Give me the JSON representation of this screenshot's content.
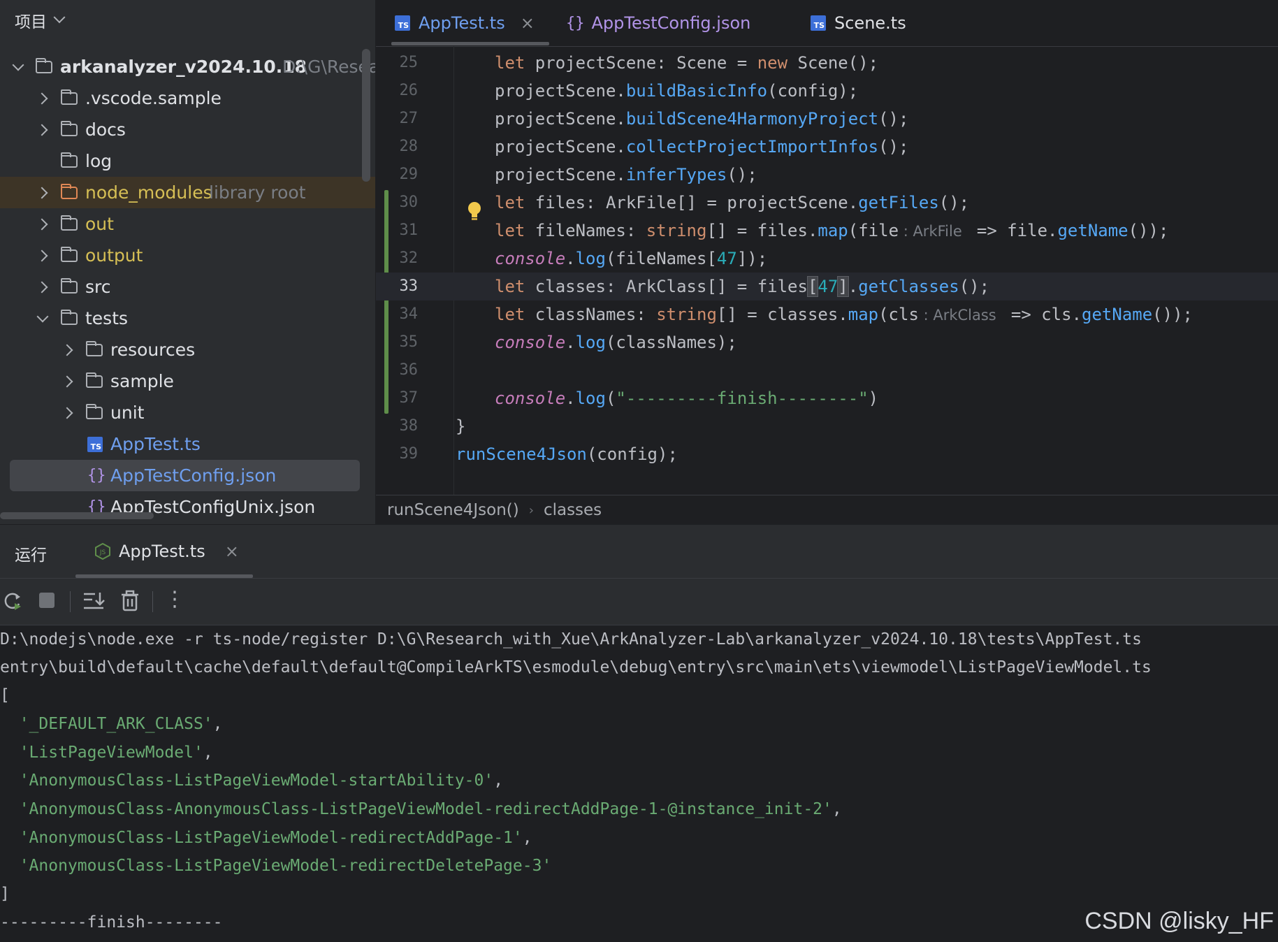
{
  "project_panel": {
    "title": "项目",
    "tree": [
      {
        "label": "arkanalyzer_v2024.10.18",
        "hint": "D:\\G\\Resea"
      },
      {
        "label": ".vscode.sample"
      },
      {
        "label": "docs"
      },
      {
        "label": "log"
      },
      {
        "label": "node_modules",
        "hint": "library root"
      },
      {
        "label": "out"
      },
      {
        "label": "output"
      },
      {
        "label": "src"
      },
      {
        "label": "tests"
      },
      {
        "label": "resources"
      },
      {
        "label": "sample"
      },
      {
        "label": "unit"
      },
      {
        "label": "AppTest.ts",
        "icon": "TS"
      },
      {
        "label": "AppTestConfig.json",
        "icon": "{}"
      },
      {
        "label": "AppTestConfigUnix.json",
        "icon": "{}"
      }
    ]
  },
  "editor": {
    "tabs": [
      {
        "label": "AppTest.ts",
        "icon": "TS",
        "close": "×"
      },
      {
        "label": "AppTestConfig.json",
        "icon": "{}"
      },
      {
        "label": "Scene.ts",
        "icon": "TS"
      }
    ],
    "line_numbers": [
      "25",
      "26",
      "27",
      "28",
      "29",
      "30",
      "31",
      "32",
      "33",
      "34",
      "35",
      "36",
      "37",
      "38",
      "39"
    ],
    "code": {
      "l25": {
        "let": "let",
        "a": " projectScene: Scene = ",
        "new": "new",
        "b": " Scene();"
      },
      "l26": {
        "a": "projectScene.",
        "fn": "buildBasicInfo",
        "b": "(config);"
      },
      "l27": {
        "a": "projectScene.",
        "fn": "buildScene4HarmonyProject",
        "b": "();"
      },
      "l28": {
        "a": "projectScene.",
        "fn": "collectProjectImportInfos",
        "b": "();"
      },
      "l29": {
        "a": "projectScene.",
        "fn": "inferTypes",
        "b": "();"
      },
      "l30": {
        "let": "let",
        "a": " files: ArkFile[] = projectScene.",
        "fn": "getFiles",
        "b": "();"
      },
      "l31": {
        "let": "let",
        "a": " fileNames: ",
        "type": "string",
        "b": "[] = files.",
        "fn": "map",
        "c": "(file",
        "hint": " : ArkFile ",
        "d": " => file.",
        "fn2": "getName",
        "e": "());"
      },
      "l32": {
        "console": "console",
        "dot": ".",
        "fn": "log",
        "a": "(fileNames[",
        "num": "47",
        "b": "]);"
      },
      "l33": {
        "let": "let",
        "a": " classes: ArkClass[] = files",
        "br1": "[",
        "num": "47",
        "br2": "]",
        "b": ".",
        "fn": "getClasses",
        "c": "();"
      },
      "l34": {
        "let": "let",
        "a": " classNames: ",
        "type": "string",
        "b": "[] = classes.",
        "fn": "map",
        "c": "(cls",
        "hint": " : ArkClass ",
        "d": " => cls.",
        "fn2": "getName",
        "e": "());"
      },
      "l35": {
        "console": "console",
        "dot": ".",
        "fn": "log",
        "a": "(classNames);"
      },
      "l37": {
        "console": "console",
        "dot": ".",
        "fn": "log",
        "a": "(",
        "str": "\"---------finish--------\"",
        "b": ")"
      },
      "l38": {
        "a": "}"
      },
      "l39": {
        "fn": "runScene4Json",
        "a": "(config);"
      }
    },
    "breadcrumb": [
      "runScene4Json()",
      "classes"
    ],
    "breadcrumb_sep": "›"
  },
  "run_panel": {
    "title": "运行",
    "tab_label": "AppTest.ts",
    "tab_close": "×",
    "toolbar": [
      "rerun-icon",
      "stop-icon",
      "scroll-to-end-icon",
      "clear-icon",
      "more-icon"
    ],
    "more_glyph": "⋮",
    "console_lines": [
      {
        "text": "D:\\nodejs\\node.exe -r ts-node/register D:\\G\\Research_with_Xue\\ArkAnalyzer-Lab\\arkanalyzer_v2024.10.18\\tests\\AppTest.ts"
      },
      {
        "text": "entry\\build\\default\\cache\\default\\default@CompileArkTS\\esmodule\\debug\\entry\\src\\main\\ets\\viewmodel\\ListPageViewModel.ts"
      },
      {
        "text": "["
      },
      {
        "str": "'_DEFAULT_ARK_CLASS'",
        "tail": ","
      },
      {
        "str": "'ListPageViewModel'",
        "tail": ","
      },
      {
        "str": "'AnonymousClass-ListPageViewModel-startAbility-0'",
        "tail": ","
      },
      {
        "str": "'AnonymousClass-AnonymousClass-ListPageViewModel-redirectAddPage-1-@instance_init-2'",
        "tail": ","
      },
      {
        "str": "'AnonymousClass-ListPageViewModel-redirectAddPage-1'",
        "tail": ","
      },
      {
        "str": "'AnonymousClass-ListPageViewModel-redirectDeletePage-3'",
        "tail": ""
      },
      {
        "text": "]"
      },
      {
        "text": "---------finish--------"
      }
    ]
  },
  "watermark": "CSDN @lisky_HF",
  "colors": {
    "keyword": "#cf8e6d",
    "function": "#56a8f5",
    "string": "#6aab73",
    "number": "#2aacb8",
    "italic_global": "#c77dbb",
    "ts_badge": "#3d6fd8",
    "json_icon": "#b294e8"
  }
}
